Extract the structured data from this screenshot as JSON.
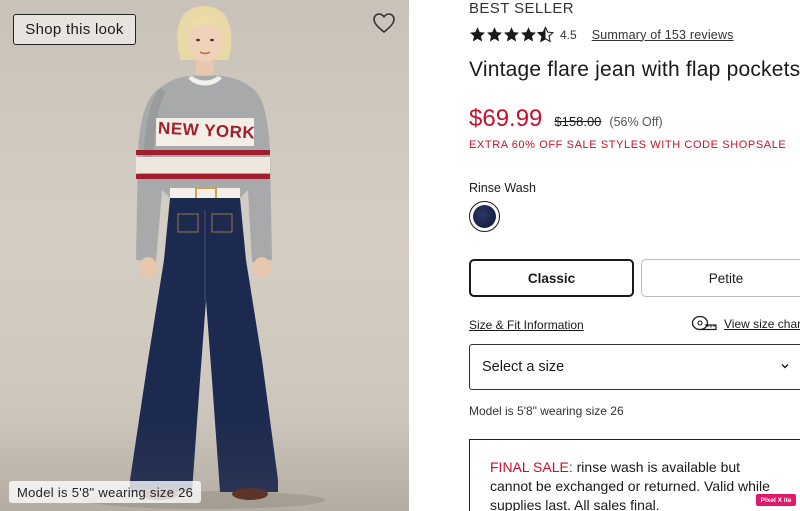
{
  "photo": {
    "shop_look_label": "Shop this look",
    "sweater_text": "NEW YORK CIT",
    "model_caption": "Model is 5'8\" wearing size 26",
    "favorite_icon": "heart-outline-icon"
  },
  "product": {
    "badge": "BEST SELLER",
    "rating_value": "4.5",
    "rating_stars": 4.5,
    "reviews_link": "Summary of 153 reviews",
    "title": "Vintage flare jean with flap pockets",
    "price_sale": "$69.99",
    "price_original": "$158.00",
    "price_discount": "(56% Off)",
    "promo": "EXTRA 60% OFF SALE STYLES WITH CODE SHOPSALE",
    "color_label": "Rinse Wash",
    "swatch_color": "#1c2850",
    "fit_options": [
      "Classic",
      "Petite"
    ],
    "fit_selected": "Classic",
    "size_fit_link": "Size & Fit Information",
    "size_chart_link": "View size chart",
    "size_select_placeholder": "Select a size",
    "model_note": "Model is 5'8\" wearing size 26",
    "final_sale_label": "FINAL SALE:",
    "final_sale_text": " rinse wash is available but cannot be exchanged or returned. Valid while supplies last. All sales final."
  },
  "overlay": {
    "badge_text": "Pixel X ite"
  },
  "colors": {
    "sale_red": "#c8102e",
    "text_dark": "#1a1a1a",
    "denim": "#1c2850"
  }
}
